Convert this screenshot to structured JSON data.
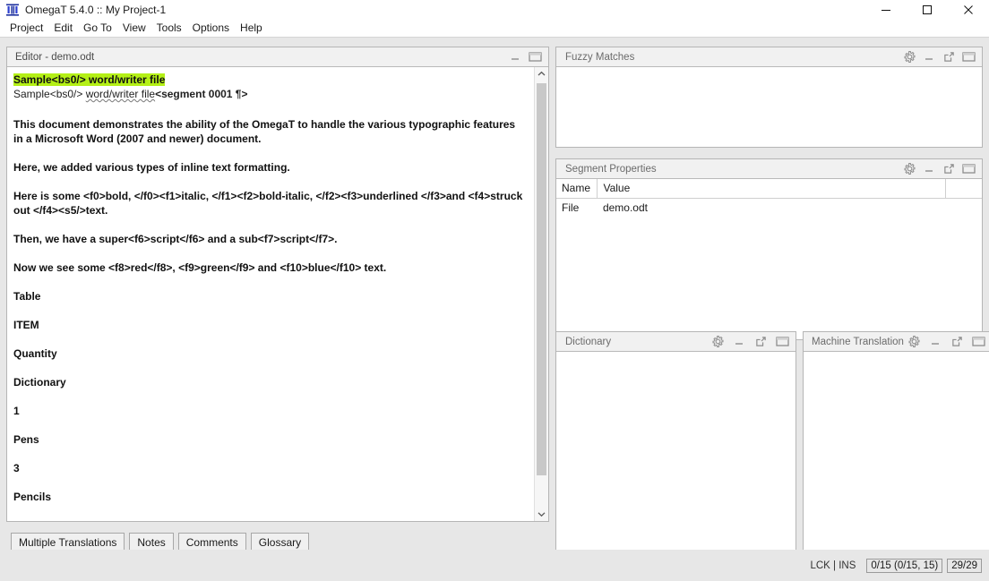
{
  "window": {
    "title": "OmegaT 5.4.0 :: My Project-1",
    "app_icon": "omegat-logo-icon",
    "controls": {
      "minimize": "minimize-icon",
      "maximize": "maximize-icon",
      "close": "close-icon"
    }
  },
  "menubar": {
    "items": [
      {
        "label": "Project"
      },
      {
        "label": "Edit"
      },
      {
        "label": "Go To"
      },
      {
        "label": "View"
      },
      {
        "label": "Tools"
      },
      {
        "label": "Options"
      },
      {
        "label": "Help"
      }
    ]
  },
  "editor": {
    "title": "Editor - demo.odt",
    "buttons": {
      "minimize": "minimize-icon",
      "maximize": "maximize-icon"
    },
    "segment": {
      "source_highlighted": "Sample<bs0/> word/writer file",
      "target_prefix": "Sample<bs0/> ",
      "target_spellchecked": "word/writer file",
      "target_marker": "<segment 0001 ¶>"
    },
    "paragraphs": [
      "This document demonstrates the ability of the OmegaT to handle the various typographic features in a Microsoft Word (2007 and newer) document.",
      "Here, we added various types of inline text formatting.",
      "Here is some <f0>bold, </f0><f1>italic, </f1><f2>bold-italic, </f2><f3>underlined </f3>and <f4>struck out </f4><s5/>text.",
      "Then, we have a super<f6>script</f6> and a sub<f7>script</f7>.",
      "Now we see some <f8>red</f8>, <f9>green</f9> and <f10>blue</f10> text.",
      "Table",
      "ITEM",
      "Quantity",
      "Dictionary",
      "1",
      "Pens",
      "3",
      "Pencils"
    ],
    "scrollbar": {
      "up_arrow": "chevron-up-icon",
      "down_arrow": "chevron-down-icon"
    }
  },
  "panels": {
    "fuzzy_matches": {
      "title": "Fuzzy Matches",
      "buttons": {
        "settings": "gear-icon",
        "minimize": "minimize-icon",
        "undock": "external-link-icon",
        "maximize": "maximize-icon"
      },
      "content": ""
    },
    "segment_properties": {
      "title": "Segment Properties",
      "buttons": {
        "settings": "gear-icon",
        "minimize": "minimize-icon",
        "undock": "external-link-icon",
        "maximize": "maximize-icon"
      },
      "columns": [
        "Name",
        "Value",
        ""
      ],
      "rows": [
        {
          "name": "File",
          "value": "demo.odt"
        }
      ]
    },
    "dictionary": {
      "title": "Dictionary",
      "buttons": {
        "settings": "gear-icon",
        "minimize": "minimize-icon",
        "undock": "external-link-icon",
        "maximize": "maximize-icon"
      },
      "content": ""
    },
    "machine_translation": {
      "title": "Machine Translation",
      "buttons": {
        "settings": "gear-icon",
        "minimize": "minimize-icon",
        "undock": "external-link-icon",
        "maximize": "maximize-icon"
      },
      "content": ""
    }
  },
  "bottom_tabs": [
    {
      "label": "Multiple Translations"
    },
    {
      "label": "Notes"
    },
    {
      "label": "Comments"
    },
    {
      "label": "Glossary"
    }
  ],
  "statusbar": {
    "lock_insert": "LCK | INS",
    "segment_counts": "0/15 (0/15, 15)",
    "file_counts": "29/29"
  },
  "colors": {
    "active_segment_highlight": "#b4f016",
    "panel_titlebar": "#f1f1f1",
    "window_background": "#e7e7e7",
    "panel_title_text": "#6b6b6b"
  }
}
